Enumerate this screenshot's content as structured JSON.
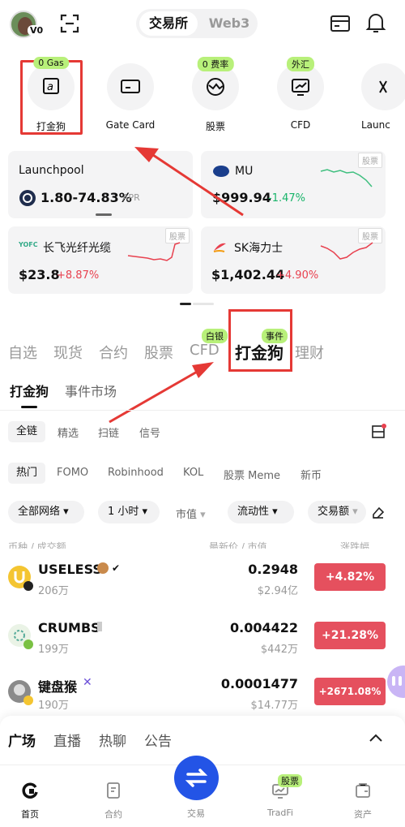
{
  "header": {
    "avatar_badge": "V0",
    "seg_active": "交易所",
    "seg_other": "Web3"
  },
  "shortcuts": [
    {
      "label": "打金狗",
      "tag": "0 Gas"
    },
    {
      "label": "Gate Card",
      "tag": ""
    },
    {
      "label": "股票",
      "tag": "0 费率"
    },
    {
      "label": "CFD",
      "tag": "外汇"
    },
    {
      "label": "Launc",
      "tag": ""
    }
  ],
  "cards": {
    "launchpool": {
      "title": "Launchpool",
      "value": "1.80-74.83%",
      "unit": "APR"
    },
    "mu": {
      "name": "MU",
      "price": "$999.94",
      "change": "-1.47%",
      "tag": "股票"
    },
    "fiber": {
      "name": "长飞光纤光缆",
      "price": "$23.8",
      "change": "+8.87%",
      "tag": "股票"
    },
    "sk": {
      "name": "SK海力士",
      "price": "$1,402.44",
      "change": "+4.90%",
      "tag": "股票"
    }
  },
  "main_tabs": [
    "自选",
    "现货",
    "合约",
    "股票",
    "CFD",
    "打金狗",
    "理财"
  ],
  "tab_badges": {
    "cfd": "白银",
    "dajingou": "事件"
  },
  "sub_tabs": [
    "打金狗",
    "事件市场"
  ],
  "filters1": [
    "全链",
    "精选",
    "扫链",
    "信号"
  ],
  "filters2": [
    "热门",
    "FOMO",
    "Robinhood",
    "KOL",
    "股票 Meme",
    "新币"
  ],
  "selects": [
    "全部网络",
    "1 小时",
    "市值",
    "流动性",
    "交易额"
  ],
  "columns": {
    "left": "币种 / 成交额",
    "mid": "最新价 / 市值",
    "right": "涨跌幅"
  },
  "rows": [
    {
      "name": "USELESS",
      "vol": "206万",
      "price": "0.2948",
      "mcap": "$2.94亿",
      "change": "+4.82%"
    },
    {
      "name": "CRUMBS",
      "vol": "199万",
      "price": "0.004422",
      "mcap": "$442万",
      "change": "+21.28%"
    },
    {
      "name": "键盘猴",
      "vol": "190万",
      "price": "0.0001477",
      "mcap": "$14.77万",
      "change": "+2671.08%"
    }
  ],
  "bottom_tabs": [
    "广场",
    "直播",
    "热聊",
    "公告"
  ],
  "nav": [
    {
      "label": "首页"
    },
    {
      "label": "合约"
    },
    {
      "label": "交易"
    },
    {
      "label": "TradFi",
      "tag": "股票"
    },
    {
      "label": "资产"
    }
  ],
  "colors": {
    "positive": "#e8414f",
    "negative": "#18b46a",
    "trade_button": "#2354e6",
    "tag_green": "#b8f07a",
    "annotation_red": "#e53935"
  }
}
